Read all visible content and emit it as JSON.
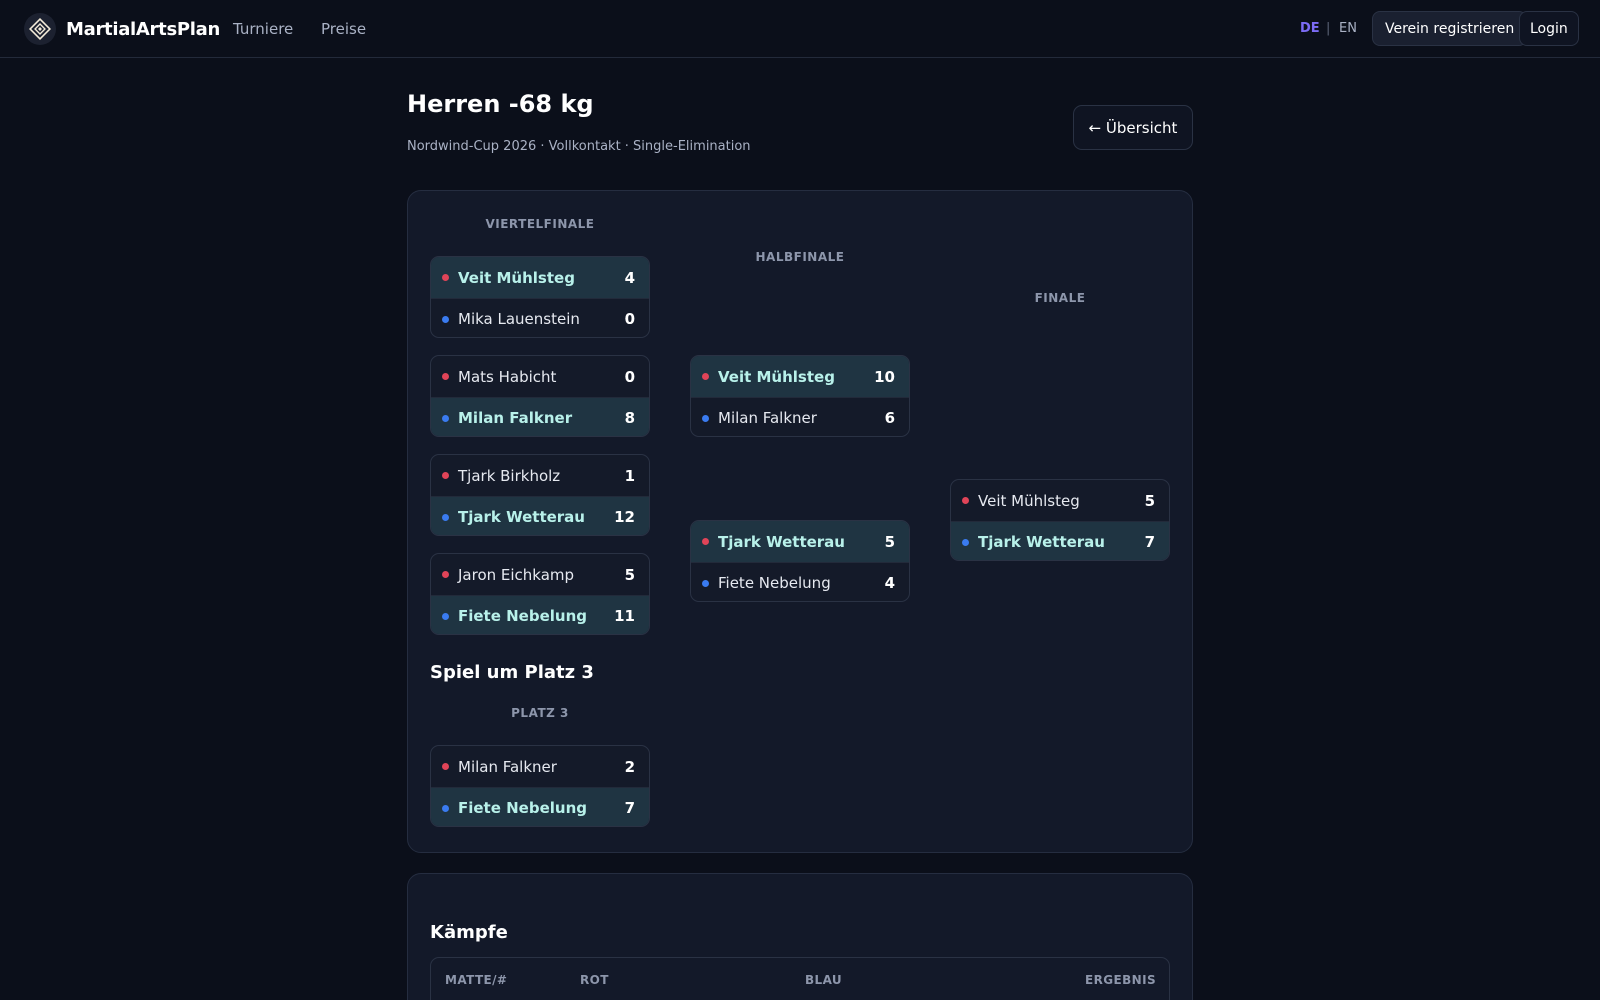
{
  "app": {
    "name": "MartialArtsPlan"
  },
  "nav": {
    "tournaments": "Turniere",
    "prices": "Preise"
  },
  "lang": {
    "de": "DE",
    "sep": "|",
    "en": "EN"
  },
  "actions": {
    "register": "Verein registrieren",
    "login": "Login"
  },
  "page": {
    "title": "Herren -68 kg",
    "subtitle": "Nordwind-Cup 2026 · Vollkontakt · Single-Elimination",
    "back": "← Übersicht"
  },
  "bracket": {
    "rounds": {
      "quarter": "VIERTELFINALE",
      "semi": "HALBFINALE",
      "final": "FINALE"
    },
    "quarterfinals": [
      {
        "red": {
          "name": "Veit Mühlsteg",
          "score": "4"
        },
        "blue": {
          "name": "Mika Lauenstein",
          "score": "0"
        },
        "winner": "red"
      },
      {
        "red": {
          "name": "Mats Habicht",
          "score": "0"
        },
        "blue": {
          "name": "Milan Falkner",
          "score": "8"
        },
        "winner": "blue"
      },
      {
        "red": {
          "name": "Tjark Birkholz",
          "score": "1"
        },
        "blue": {
          "name": "Tjark Wetterau",
          "score": "12"
        },
        "winner": "blue"
      },
      {
        "red": {
          "name": "Jaron Eichkamp",
          "score": "5"
        },
        "blue": {
          "name": "Fiete Nebelung",
          "score": "11"
        },
        "winner": "blue"
      }
    ],
    "semifinals": [
      {
        "red": {
          "name": "Veit Mühlsteg",
          "score": "10"
        },
        "blue": {
          "name": "Milan Falkner",
          "score": "6"
        },
        "winner": "red"
      },
      {
        "red": {
          "name": "Tjark Wetterau",
          "score": "5"
        },
        "blue": {
          "name": "Fiete Nebelung",
          "score": "4"
        },
        "winner": "red"
      }
    ],
    "final": {
      "red": {
        "name": "Veit Mühlsteg",
        "score": "5"
      },
      "blue": {
        "name": "Tjark Wetterau",
        "score": "7"
      },
      "winner": "blue"
    },
    "third_place_heading": "Spiel um Platz 3",
    "third_place_label": "PLATZ 3",
    "third_place": {
      "red": {
        "name": "Milan Falkner",
        "score": "2"
      },
      "blue": {
        "name": "Fiete Nebelung",
        "score": "7"
      },
      "winner": "blue"
    }
  },
  "fights": {
    "heading": "Kämpfe",
    "columns": {
      "mat": "MATTE/#",
      "red": "ROT",
      "blue": "BLAU",
      "result": "ERGEBNIS"
    }
  },
  "colors": {
    "accent": "#7c6cf5",
    "red_corner": "#e04458",
    "blue_corner": "#3a7bf0",
    "winner_bg": "#1f3442"
  }
}
